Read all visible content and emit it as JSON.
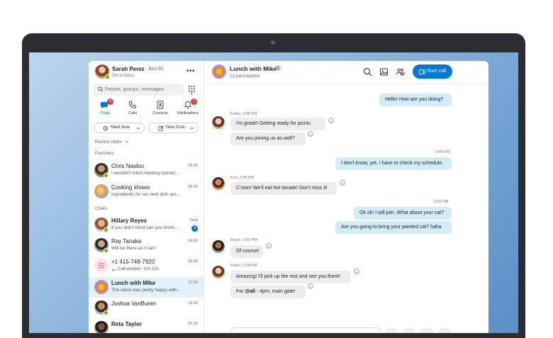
{
  "profile": {
    "name": "Sarah Perez",
    "credit": "$22.00",
    "status": "Set a status"
  },
  "search": {
    "placeholder": "People, groups, messages"
  },
  "nav": [
    {
      "label": "Chats",
      "badge": "3"
    },
    {
      "label": "Calls"
    },
    {
      "label": "Contacts"
    },
    {
      "label": "Notifications",
      "badge": "1"
    }
  ],
  "buttons": {
    "meet_now": "Meet Now",
    "new_chat": "New Chat"
  },
  "sections": {
    "recent": "Recent chats",
    "favorites": "Favorites",
    "chats": "Chats"
  },
  "favorites": [
    {
      "name": "Chris Naidoo",
      "preview": "I wouldn't mind meeting sooner...",
      "time": "18:03"
    },
    {
      "name": "Cooking shows",
      "preview": "Ingredients for our next dish are...",
      "time": "05.03"
    }
  ],
  "chats": [
    {
      "name": "Hillary Reyes",
      "preview": "If you don't mind can you finish...",
      "time": "Now",
      "badge": "3"
    },
    {
      "name": "Ray Tanaka",
      "preview": "Will be there as I can!",
      "time": "14:42"
    },
    {
      "name": "+1 415-748-7920",
      "preview": "Call ended - 1m 22s",
      "time": "24.03"
    },
    {
      "name": "Lunch with Mike",
      "preview": "The client was pretty happy with...",
      "time": "17:03"
    },
    {
      "name": "Joshua VanBuren",
      "preview": "",
      "time": "16.03"
    },
    {
      "name": "Reta Taylor",
      "preview": "",
      "time": "16.03"
    }
  ],
  "conversation": {
    "title": "Lunch with Mike",
    "subtitle": "12 participants",
    "start_call": "Start call",
    "messages": [
      {
        "text": "Hello! How are you doing?"
      },
      {
        "meta": "Keiko, 2:48 PM",
        "text": "I'm great!! Getting ready for picnic."
      },
      {
        "text": "Are you joining us as well?"
      },
      {
        "meta": "2:49 PM",
        "text": "I don't know, yet. I have to check my schedule."
      },
      {
        "meta": "Eric, 2:49 PM",
        "text": "C'mon! We'll eat hot tamale! Don't miss it!"
      },
      {
        "meta": "2:53 PM",
        "text": "Ok ok! I will join. What about your cat?"
      },
      {
        "text": "Are you going to bring your painted cat? haha"
      },
      {
        "meta": "Bryan, 2:55 PM",
        "text": "Of course!"
      },
      {
        "meta": "Keiko, 2:58 PM",
        "text": "Amazing! I'll pick up the rest and see you there!"
      },
      {
        "text_prefix": "For ",
        "mention": "@all",
        "text_suffix": " - 4pm, main gate!"
      }
    ]
  },
  "colors": {
    "accent": "#0078d4",
    "out_bubble": "#d3ecfb",
    "in_bubble": "#ededed",
    "presence": "#6bb700",
    "badge": "#e23b3b"
  }
}
